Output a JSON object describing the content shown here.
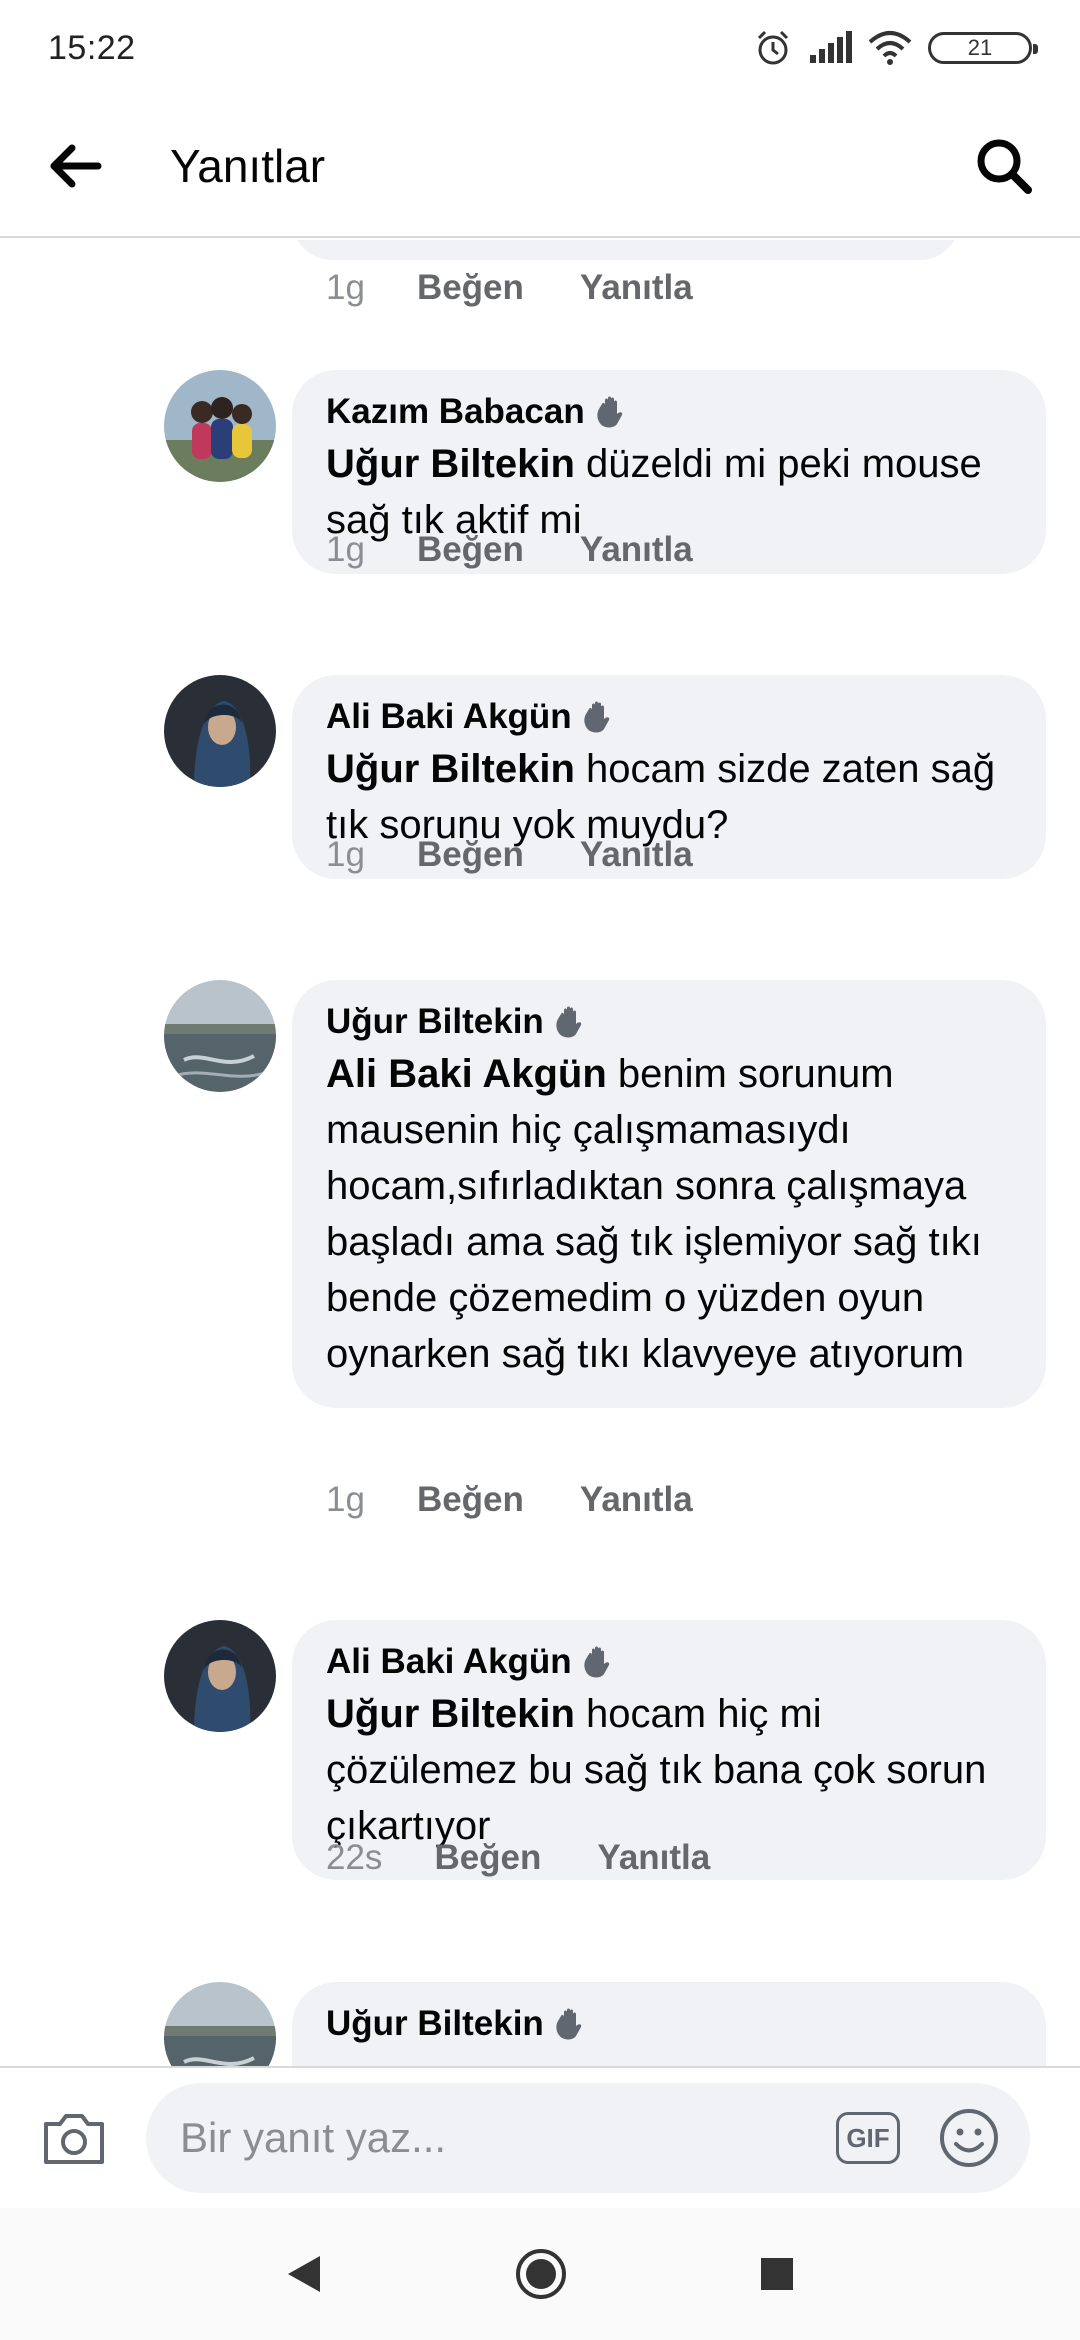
{
  "status_bar": {
    "time": "15:22",
    "battery": "21"
  },
  "header": {
    "title": "Yanıtlar"
  },
  "comments": [
    {
      "author": "",
      "mention": "",
      "text": "",
      "time": "1g",
      "like_label": "Beğen",
      "reply_label": "Yanıtla"
    },
    {
      "author": "Kazım Babacan",
      "mention": "Uğur Biltekin",
      "text": " düzeldi mi peki mouse sağ tık aktif mi",
      "time": "1g",
      "like_label": "Beğen",
      "reply_label": "Yanıtla"
    },
    {
      "author": "Ali Baki Akgün",
      "mention": "Uğur Biltekin",
      "text": " hocam sizde zaten sağ tık sorunu yok muydu?",
      "time": "1g",
      "like_label": "Beğen",
      "reply_label": "Yanıtla"
    },
    {
      "author": "Uğur Biltekin",
      "mention": "Ali Baki Akgün",
      "text": " benim sorunum mausenin hiç çalışmamasıydı hocam,sıfırladıktan sonra çalışmaya başladı ama sağ tık işlemiyor sağ tıkı bende çözemedim o yüzden oyun oynarken sağ tıkı klavyeye atıyorum",
      "time": "1g",
      "like_label": "Beğen",
      "reply_label": "Yanıtla"
    },
    {
      "author": "Ali Baki Akgün",
      "mention": "Uğur Biltekin",
      "text": " hocam hiç mi çözülemez bu sağ tık bana çok sorun çıkartıyor",
      "time": "22s",
      "like_label": "Beğen",
      "reply_label": "Yanıtla"
    },
    {
      "author": "Uğur Biltekin",
      "mention": "",
      "text": "",
      "time": "",
      "like_label": "",
      "reply_label": ""
    }
  ],
  "composer": {
    "placeholder": "Bir yanıt yaz...",
    "gif_label": "GIF"
  },
  "icons": {
    "back": "arrow-left-icon",
    "search": "search-icon",
    "camera": "camera-icon",
    "emoji": "emoji-icon",
    "wave": "wave-hand-icon"
  },
  "colors": {
    "bubble": "#f0f2f5",
    "meta": "#65676b",
    "text": "#050505"
  }
}
